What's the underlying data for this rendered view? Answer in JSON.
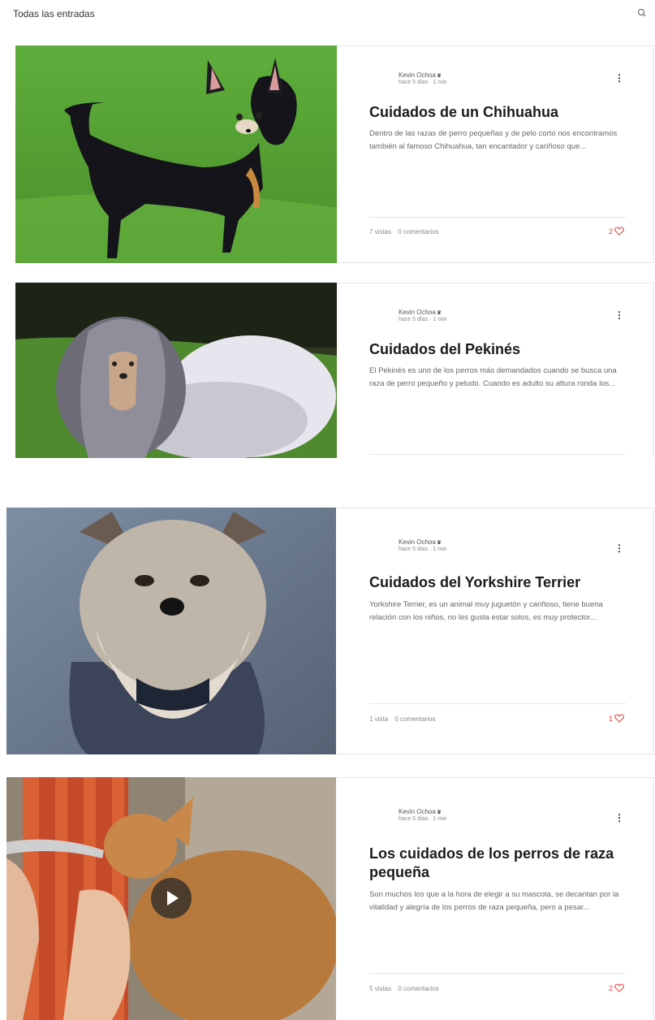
{
  "header": {
    "title": "Todas las entradas",
    "search_icon": "search-icon"
  },
  "posts": [
    {
      "author": "Kevin Ochoa",
      "meta": "hace 5 días · 1 min",
      "title": "Cuidados de un Chihuahua",
      "excerpt": "Dentro de las razas de perro pequeñas y de pelo corto nos encontramos también al famoso Chihuahua, tan encantador y cariñoso que...",
      "views": "7 vistas",
      "comments": "0 comentarios",
      "likes": "2"
    },
    {
      "author": "Kevin Ochoa",
      "meta": "hace 5 días · 1 min",
      "title": "Cuidados del Pekinés",
      "excerpt": "El Pekinés es uno de los perros más demandados cuando se busca una raza de perro pequeño y peludo. Cuando es adulto su altura ronda los...",
      "views": "",
      "comments": "",
      "likes": ""
    },
    {
      "author": "Kevin Ochoa",
      "meta": "hace 5 días · 1 min",
      "title": "Cuidados del Yorkshire Terrier",
      "excerpt": "Yorkshire Terrier, es un animal muy juguetón y cariñoso, tiene buena relación con los niños, no les gusta estar solos, es muy protector...",
      "views": "1 vista",
      "comments": "0 comentarios",
      "likes": "1"
    },
    {
      "author": "Kevin Ochoa",
      "meta": "hace 5 días · 1 min",
      "title": "Los cuidados de los perros de raza pequeña",
      "excerpt": "Son muchos los que a la hora de elegir a su mascota, se decantan por la vitalidad y alegría de los perros de raza pequeña, pero a pesar...",
      "views": "5 vistas",
      "comments": "0 comentarios",
      "likes": "2"
    }
  ],
  "colors": {
    "accent_like": "#e04545",
    "border": "#e6e6e6"
  }
}
